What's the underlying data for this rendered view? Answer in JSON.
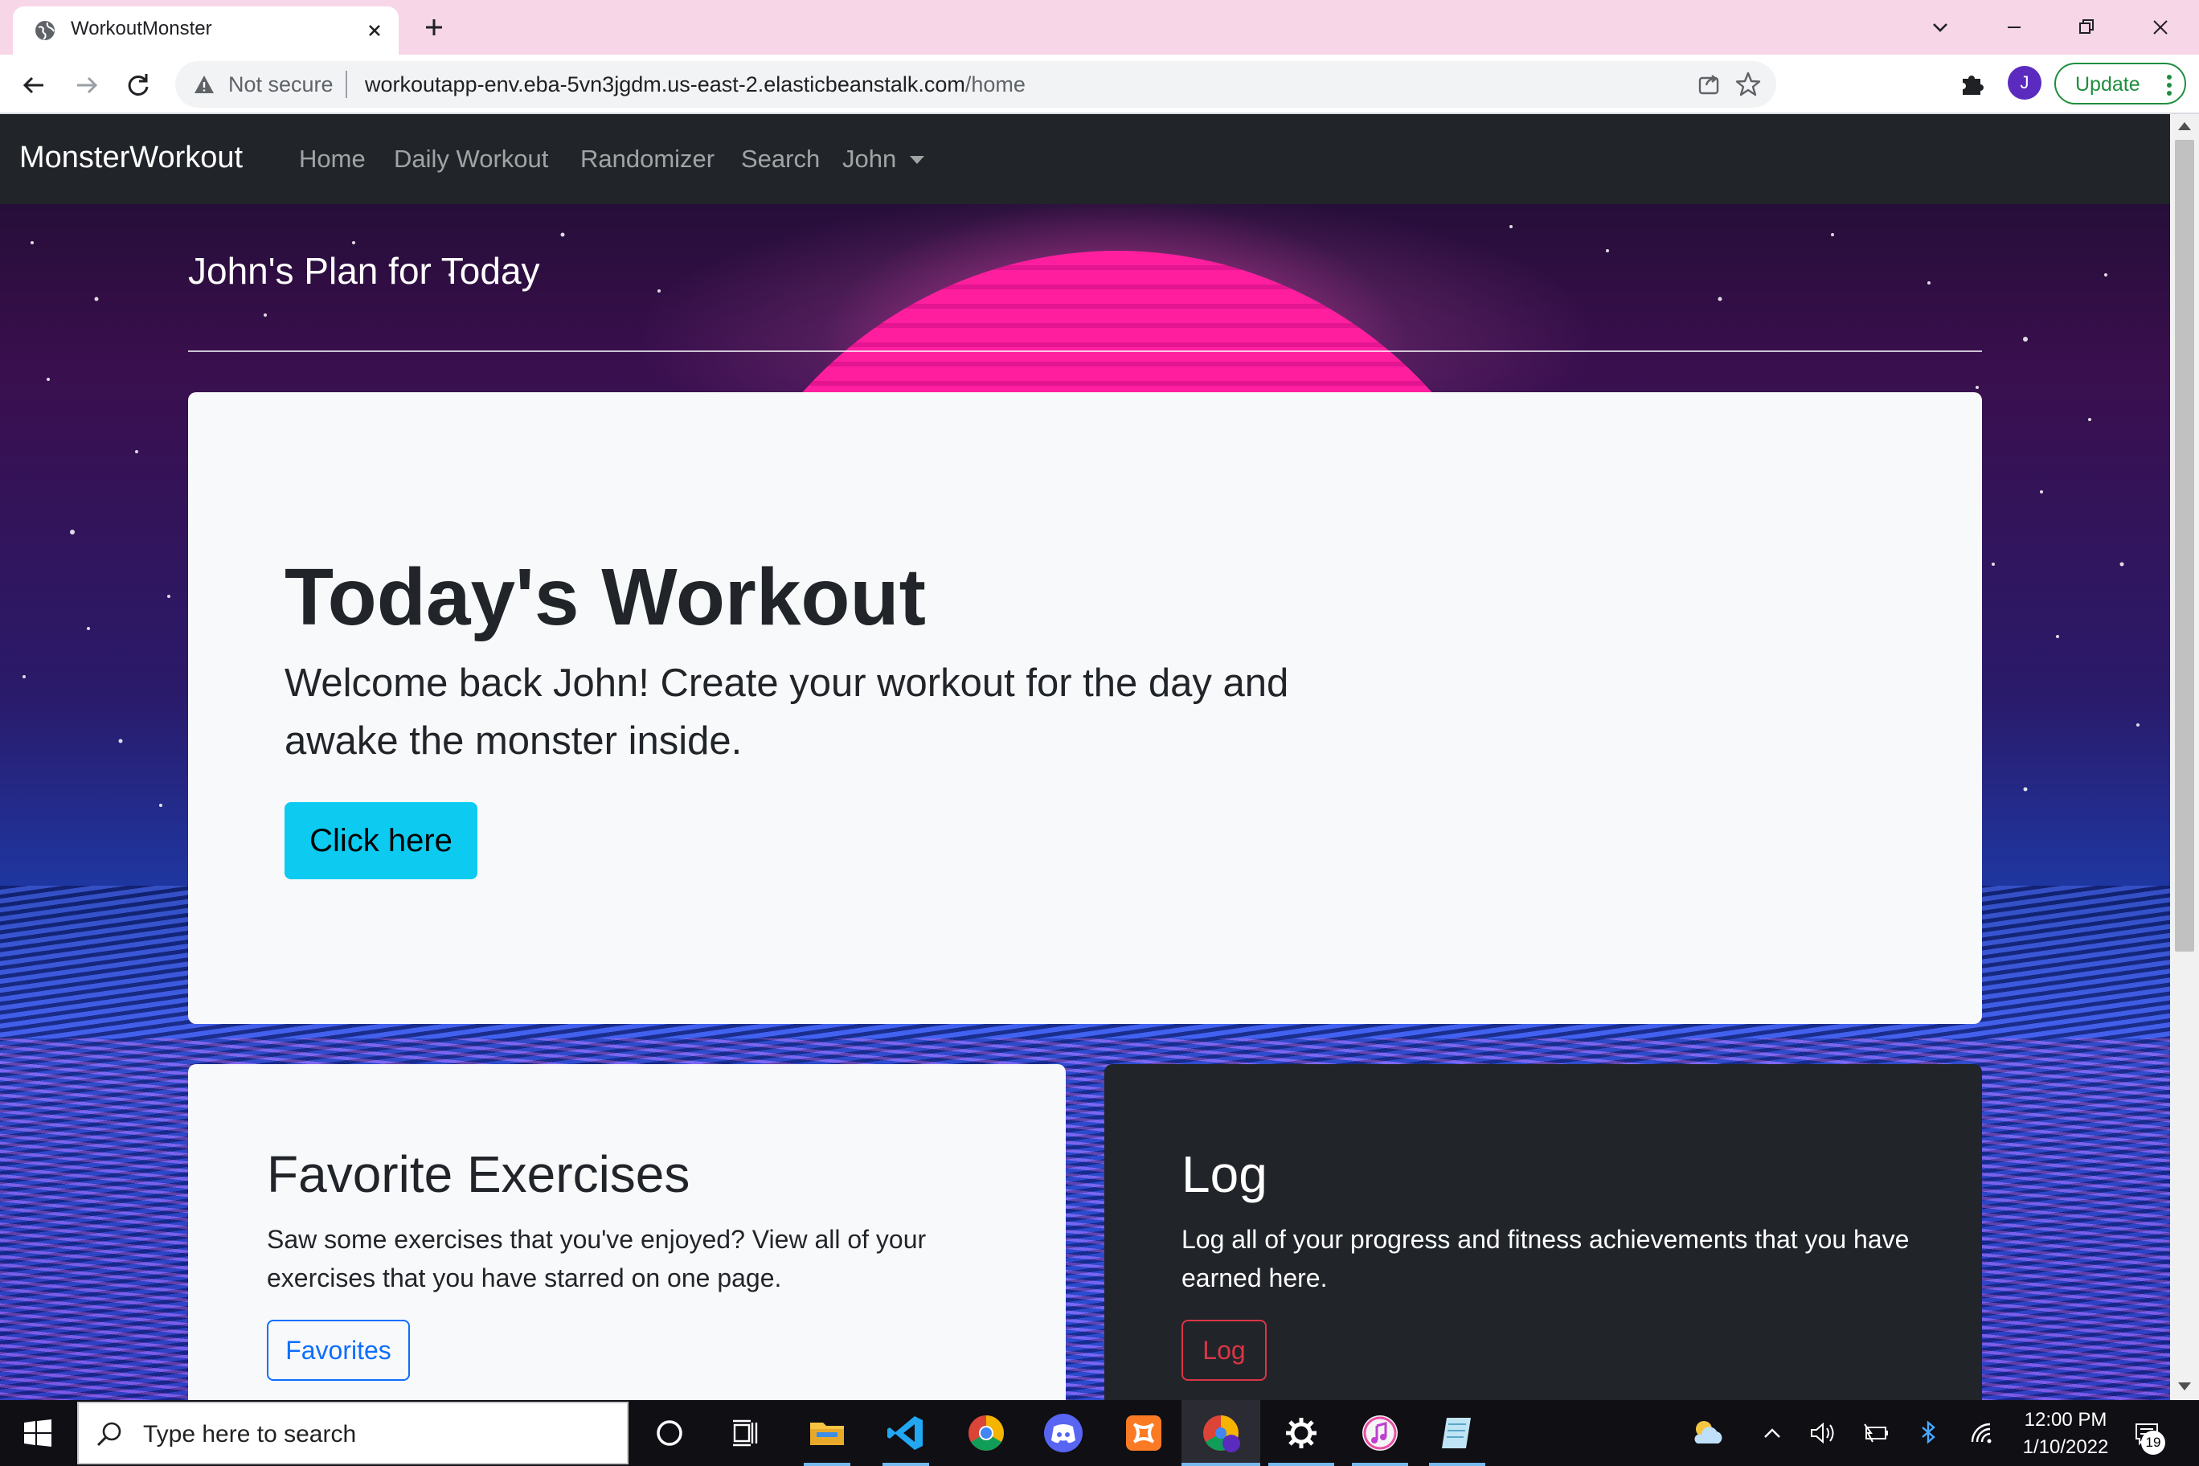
{
  "browser": {
    "tab_title": "WorkoutMonster",
    "omnibox": {
      "security_label": "Not secure",
      "url_host": "workoutapp-env.eba-5vn3jgdm.us-east-2.elasticbeanstalk.com",
      "url_path": "/home"
    },
    "profile_initial": "J",
    "update_label": "Update"
  },
  "navbar": {
    "brand": "MonsterWorkout",
    "links": [
      "Home",
      "Daily Workout",
      "Randomizer",
      "Search"
    ],
    "user_menu": "John"
  },
  "page": {
    "plan_title": "John's Plan for Today",
    "jumbotron": {
      "heading": "Today's Workout",
      "text": "Welcome back John! Create your workout for the day and awake the monster inside.",
      "button": "Click here"
    },
    "cards": [
      {
        "title": "Favorite Exercises",
        "text": "Saw some exercises that you've enjoyed? View all of your exercises that you have starred on one page.",
        "button": "Favorites"
      },
      {
        "title": "Log",
        "text": "Log all of your progress and fitness achievements that you have earned here.",
        "button": "Log"
      }
    ]
  },
  "taskbar": {
    "search_placeholder": "Type here to search",
    "time": "12:00 PM",
    "date": "1/10/2022",
    "notification_count": "19"
  },
  "colors": {
    "navbar_bg": "#212529",
    "info_button": "#0dcaf0",
    "primary_outline": "#0d6efd",
    "danger_outline": "#dc3545",
    "tabstrip": "#f7d6e8"
  }
}
